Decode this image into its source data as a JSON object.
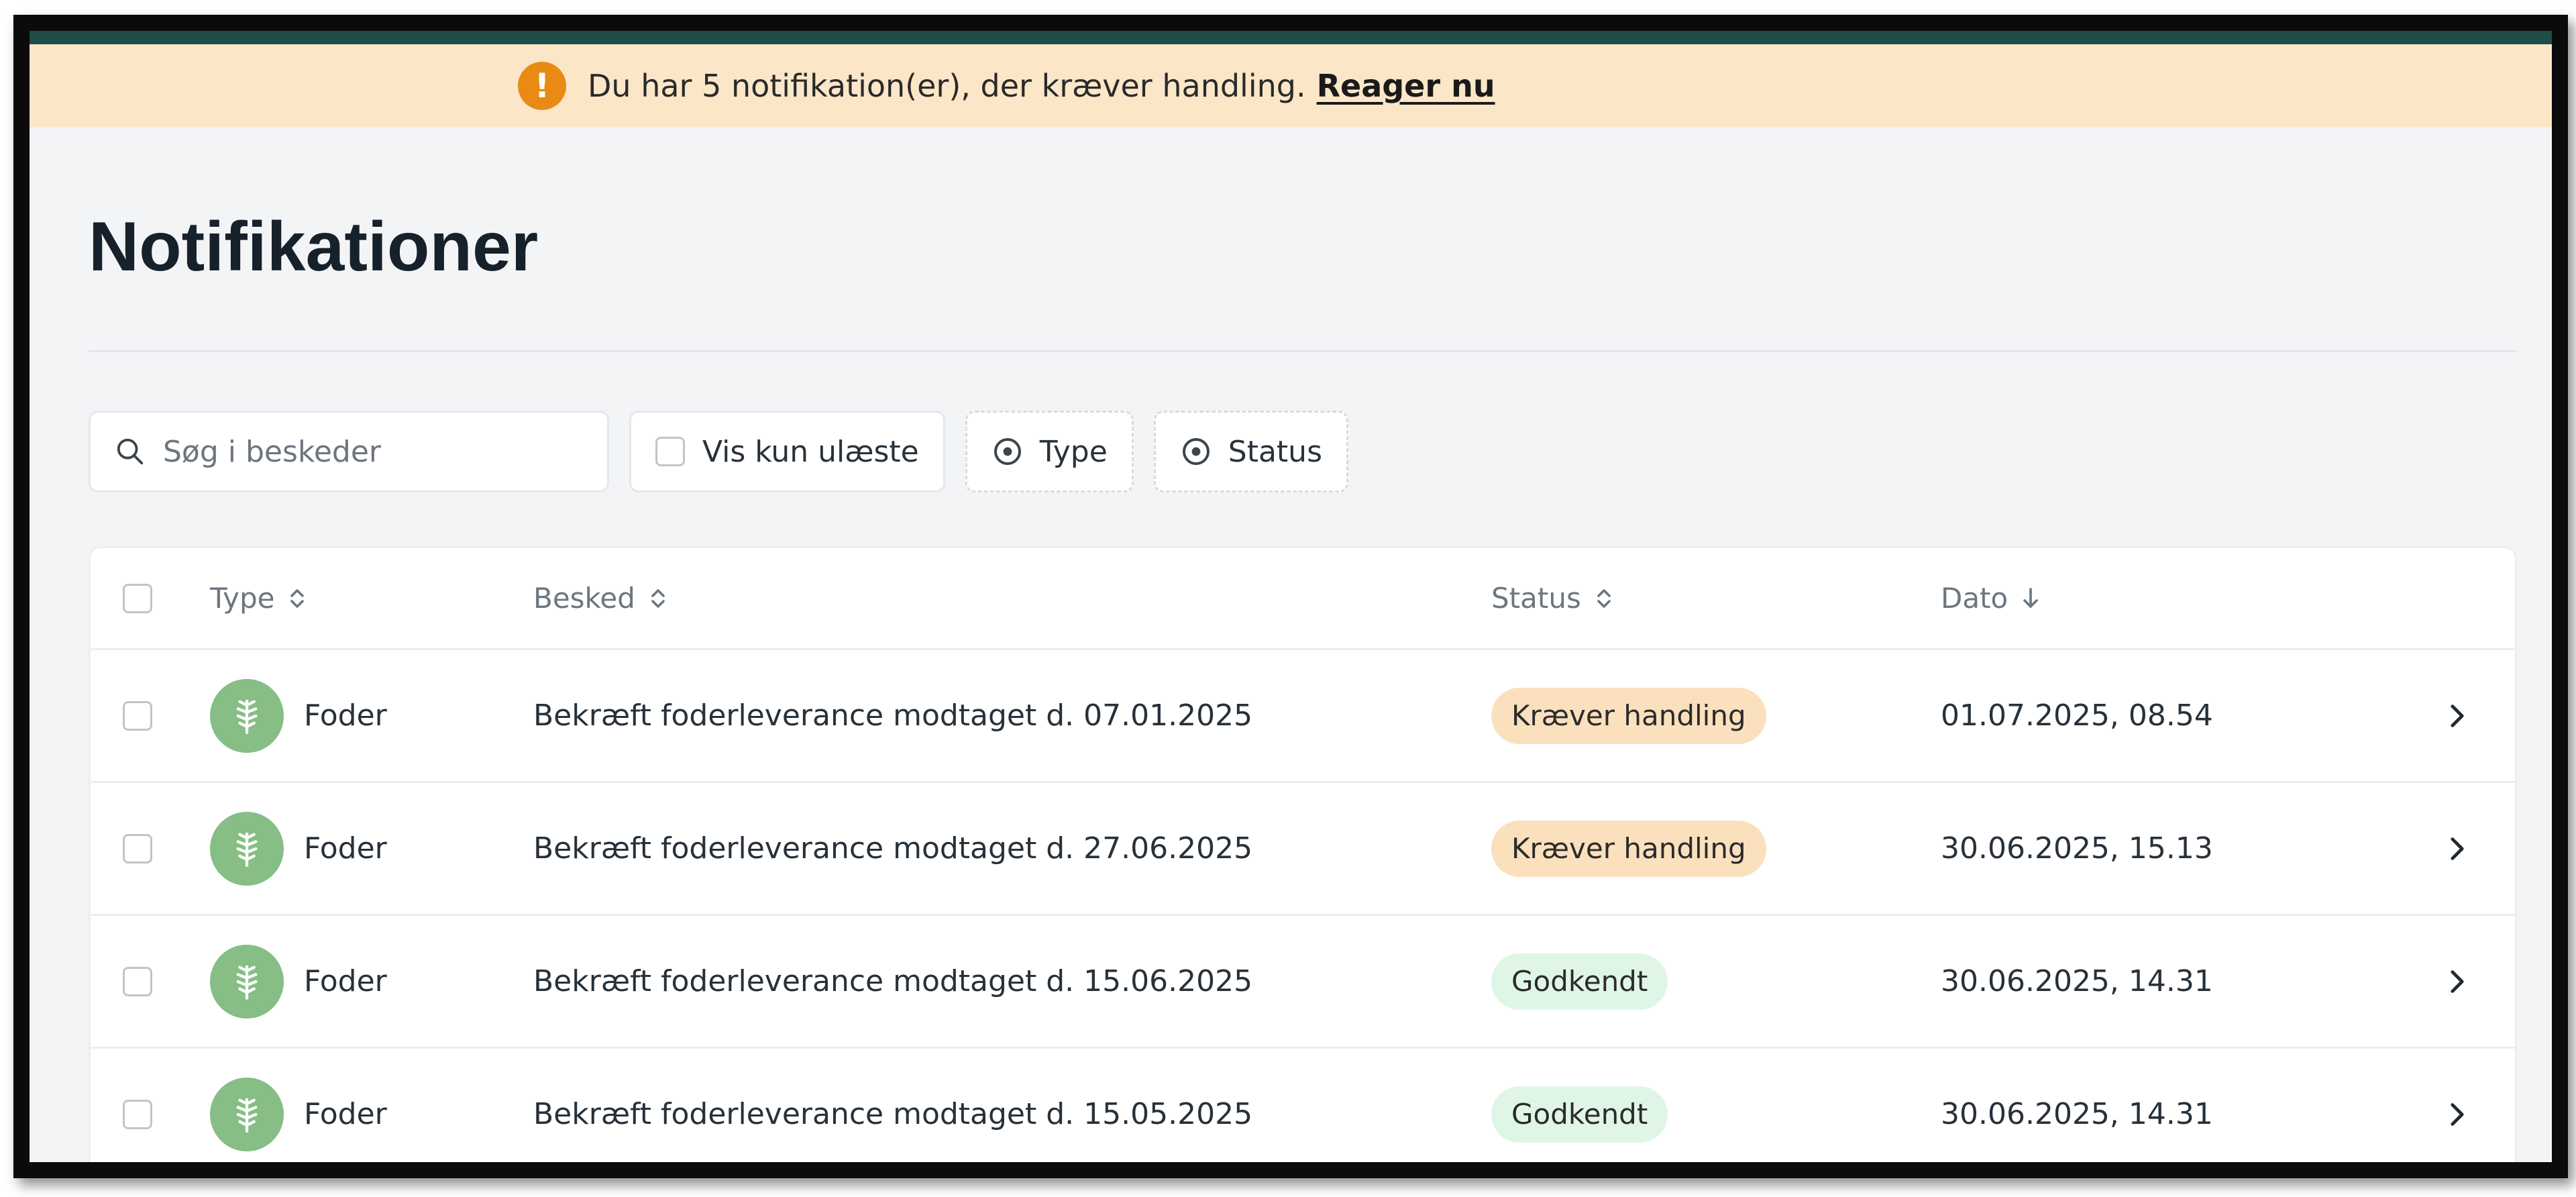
{
  "banner": {
    "message": "Du har 5 notifikation(er), der kræver handling.",
    "link": "Reager nu",
    "icon": "exclamation-icon",
    "accent": "#e88a14",
    "background": "#fbe7c8"
  },
  "page": {
    "title": "Notifikationer"
  },
  "filters": {
    "search_placeholder": "Søg i beskeder",
    "unread_label": "Vis kun ulæste",
    "type_label": "Type",
    "status_label": "Status"
  },
  "table": {
    "columns": {
      "type": "Type",
      "message": "Besked",
      "status": "Status",
      "date": "Dato"
    },
    "rows": [
      {
        "type": "Foder",
        "message": "Bekræft foderleverance modtaget d. 07.01.2025",
        "status": "Kræver handling",
        "date": "01.07.2025, 08.54"
      },
      {
        "type": "Foder",
        "message": "Bekræft foderleverance modtaget d. 27.06.2025",
        "status": "Kræver handling",
        "date": "30.06.2025, 15.13"
      },
      {
        "type": "Foder",
        "message": "Bekræft foderleverance modtaget d. 15.06.2025",
        "status": "Godkendt",
        "date": "30.06.2025, 14.31"
      },
      {
        "type": "Foder",
        "message": "Bekræft foderleverance modtaget d. 15.05.2025",
        "status": "Godkendt",
        "date": "30.06.2025, 14.31"
      }
    ]
  },
  "colors": {
    "top_strip": "#1e4d48",
    "status_action_bg": "#fbe0bd",
    "status_ok_bg": "#dff6e6",
    "type_icon_bg": "#86be85"
  }
}
